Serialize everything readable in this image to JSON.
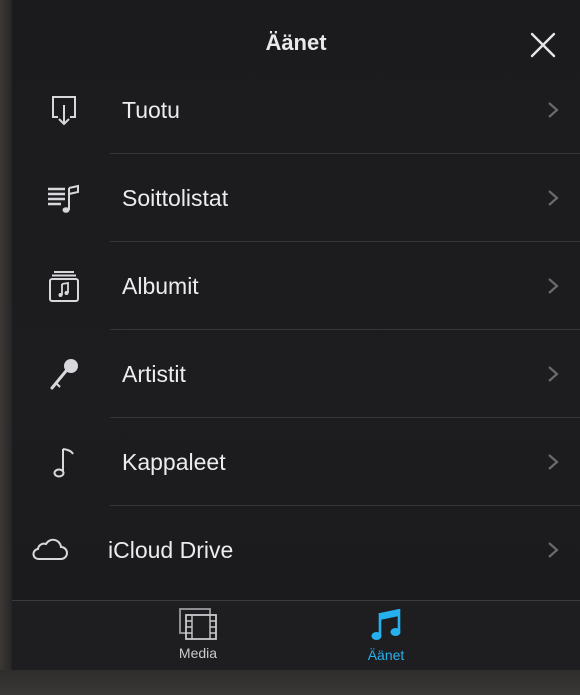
{
  "header": {
    "title": "Äänet"
  },
  "list": {
    "items": [
      {
        "label": "Tuotu",
        "icon": "import-icon"
      },
      {
        "label": "Soittolistat",
        "icon": "playlist-icon"
      },
      {
        "label": "Albumit",
        "icon": "album-icon"
      },
      {
        "label": "Artistit",
        "icon": "microphone-icon"
      },
      {
        "label": "Kappaleet",
        "icon": "music-note-icon"
      },
      {
        "label": "iCloud Drive",
        "icon": "cloud-icon"
      }
    ]
  },
  "tabbar": {
    "media_label": "Media",
    "sounds_label": "Äänet",
    "active": "Äänet",
    "accent_color": "#26b0ee"
  }
}
